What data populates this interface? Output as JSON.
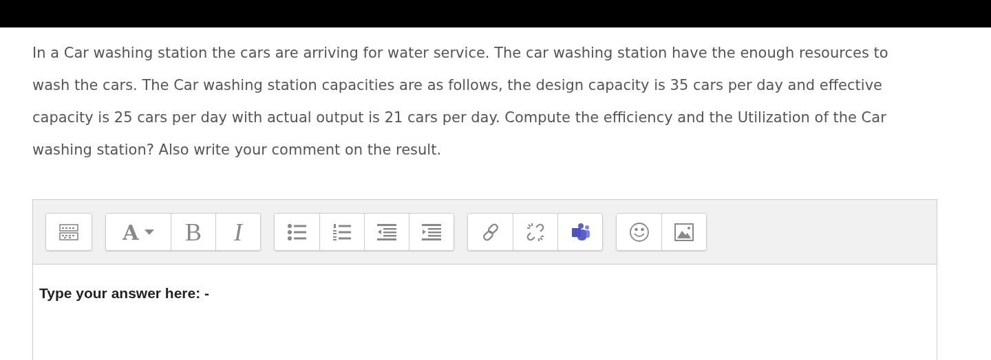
{
  "question": {
    "text": "In a Car washing station the cars are arriving for water service. The car washing station have the enough resources to wash the cars.  The Car washing station capacities are as follows, the design capacity is 35 cars per day and effective capacity is 25 cars per day with actual output is 21 cars per day. Compute the efficiency and the Utilization of the Car washing station? Also write your comment on the result."
  },
  "editor": {
    "toolbar": [
      [
        {
          "kind": "toggle"
        }
      ],
      [
        {
          "kind": "font",
          "label": "A"
        },
        {
          "kind": "bold",
          "label": "B"
        },
        {
          "kind": "italic",
          "label": "I"
        }
      ],
      [
        {
          "kind": "bullets"
        },
        {
          "kind": "numbers"
        },
        {
          "kind": "outdent"
        },
        {
          "kind": "indent"
        }
      ],
      [
        {
          "kind": "link"
        },
        {
          "kind": "unlink"
        },
        {
          "kind": "teams"
        }
      ],
      [
        {
          "kind": "emoji"
        },
        {
          "kind": "image"
        }
      ]
    ],
    "content": "Type your answer here: -"
  }
}
